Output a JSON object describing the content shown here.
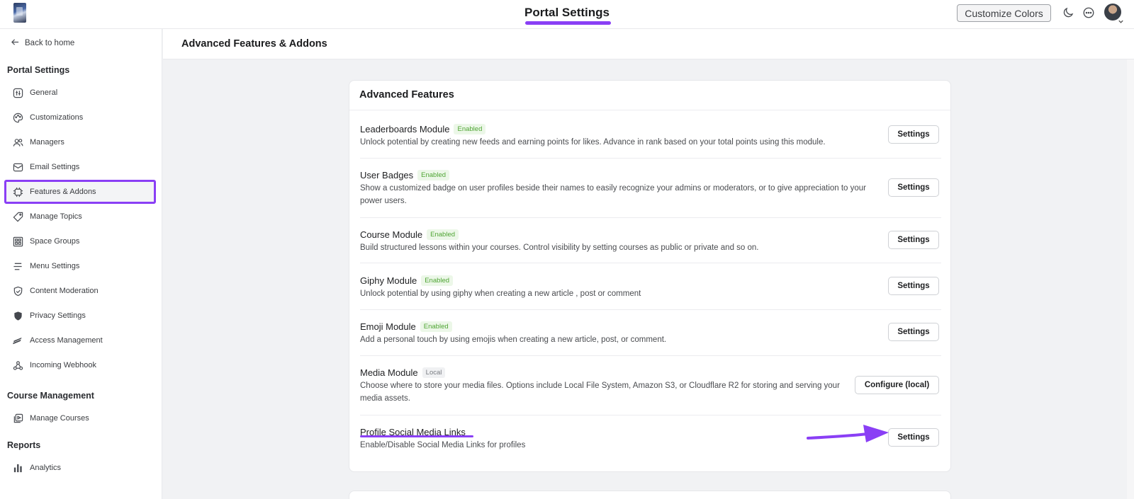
{
  "topbar": {
    "title": "Portal Settings",
    "customize_label": "Customize Colors",
    "icons": [
      "moon-icon",
      "chat-icon",
      "avatar"
    ]
  },
  "sidebar": {
    "back_label": "Back to home",
    "sections": [
      {
        "heading": "Portal Settings",
        "items": [
          {
            "label": "General",
            "icon": "general-icon"
          },
          {
            "label": "Customizations",
            "icon": "palette-icon"
          },
          {
            "label": "Managers",
            "icon": "users-icon"
          },
          {
            "label": "Email Settings",
            "icon": "mail-icon"
          },
          {
            "label": "Features & Addons",
            "icon": "chip-icon",
            "active": true
          },
          {
            "label": "Manage Topics",
            "icon": "tag-icon"
          },
          {
            "label": "Space Groups",
            "icon": "grid-icon"
          },
          {
            "label": "Menu Settings",
            "icon": "menu-icon"
          },
          {
            "label": "Content Moderation",
            "icon": "shield-check-icon"
          },
          {
            "label": "Privacy Settings",
            "icon": "shield-icon"
          },
          {
            "label": "Access Management",
            "icon": "access-icon"
          },
          {
            "label": "Incoming Webhook",
            "icon": "webhook-icon"
          }
        ]
      },
      {
        "heading": "Course Management",
        "items": [
          {
            "label": "Manage Courses",
            "icon": "courses-icon"
          }
        ]
      },
      {
        "heading": "Reports",
        "items": [
          {
            "label": "Analytics",
            "icon": "chart-icon"
          }
        ]
      }
    ]
  },
  "main": {
    "page_title": "Advanced Features & Addons",
    "card_title": "Advanced Features",
    "features": [
      {
        "name": "Leaderboards Module",
        "status": "Enabled",
        "description": "Unlock potential by creating new feeds and earning points for likes. Advance in rank based on your total points using this module.",
        "action": "Settings"
      },
      {
        "name": "User Badges",
        "status": "Enabled",
        "description": "Show a customized badge on user profiles beside their names to easily recognize your admins or moderators, or to give appreciation to your power users.",
        "action": "Settings"
      },
      {
        "name": "Course Module",
        "status": "Enabled",
        "description": "Build structured lessons within your courses. Control visibility by setting courses as public or private and so on.",
        "action": "Settings"
      },
      {
        "name": "Giphy Module",
        "status": "Enabled",
        "description": "Unlock potential by using giphy when creating a new article , post or comment",
        "action": "Settings"
      },
      {
        "name": "Emoji Module",
        "status": "Enabled",
        "description": "Add a personal touch by using emojis when creating a new article, post, or comment.",
        "action": "Settings"
      },
      {
        "name": "Media Module",
        "status": "Local",
        "description": "Choose where to store your media files. Options include Local File System, Amazon S3, or Cloudflare R2 for storing and serving your media assets.",
        "action": "Configure (local)"
      },
      {
        "name": "Profile Social Media Links",
        "status": "",
        "description": "Enable/Disable Social Media Links for profiles",
        "action": "Settings"
      }
    ]
  },
  "colors": {
    "accent": "#8a3ff5",
    "enabled_badge_bg": "#ecf7e8",
    "enabled_badge_text": "#4fa534"
  }
}
